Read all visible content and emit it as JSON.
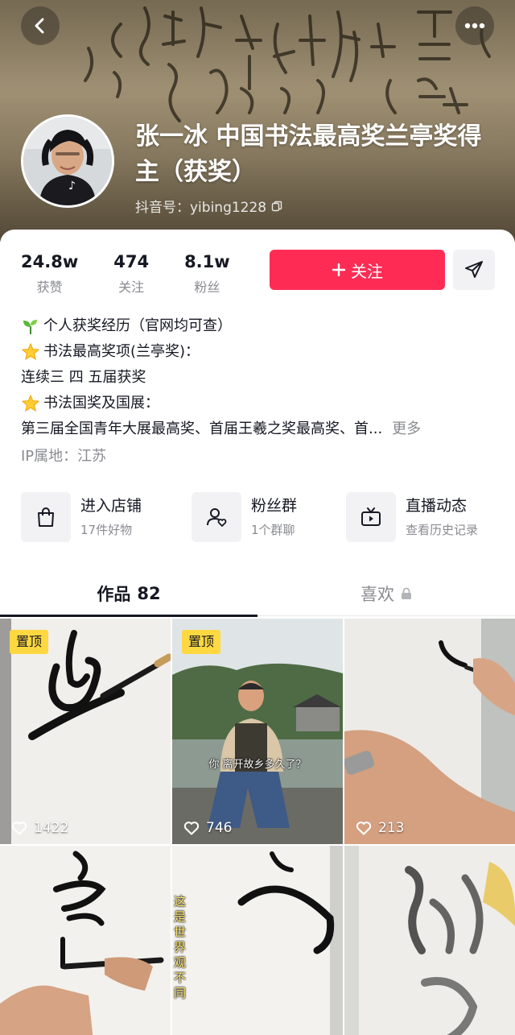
{
  "header": {
    "nickname": "张一冰 中国书法最高奖兰亭奖得主（获奖）",
    "douyin_id": "抖音号：yibing1228"
  },
  "stats": [
    {
      "value": "24.8w",
      "label": "获赞"
    },
    {
      "value": "474",
      "label": "关注"
    },
    {
      "value": "8.1w",
      "label": "粉丝"
    }
  ],
  "actions": {
    "follow_label": "关注"
  },
  "bio": {
    "line1": "个人获奖经历（官网均可查）",
    "line2": "书法最高奖项(兰亭奖)：",
    "line3": "连续三 四 五届获奖",
    "line4": "书法国奖及国展：",
    "line5": "第三届全国青年大展最高奖、首届王羲之奖最高奖、首...",
    "more": "更多",
    "ip": "IP属地：江苏"
  },
  "shortcuts": [
    {
      "title": "进入店铺",
      "subtitle": "17件好物",
      "icon": "shopping-bag-icon"
    },
    {
      "title": "粉丝群",
      "subtitle": "1个群聊",
      "icon": "fan-group-icon"
    },
    {
      "title": "直播动态",
      "subtitle": "查看历史记录",
      "icon": "tv-icon"
    }
  ],
  "tabs": {
    "works_label": "作品",
    "works_count": "82",
    "likes_label": "喜欢"
  },
  "videos": [
    {
      "pinned_label": "置顶",
      "likes": "1422"
    },
    {
      "pinned_label": "置顶",
      "likes": "746",
      "subtitle": "你 离开故乡多久了？"
    },
    {
      "likes": "213"
    },
    {
      "likes": ""
    },
    {
      "caption": "这是世界观不同"
    },
    {
      "likes": ""
    }
  ],
  "colors": {
    "accent": "#fe2c55",
    "pin_badge": "#fdd840",
    "secondary_text": "#8a8b91"
  }
}
